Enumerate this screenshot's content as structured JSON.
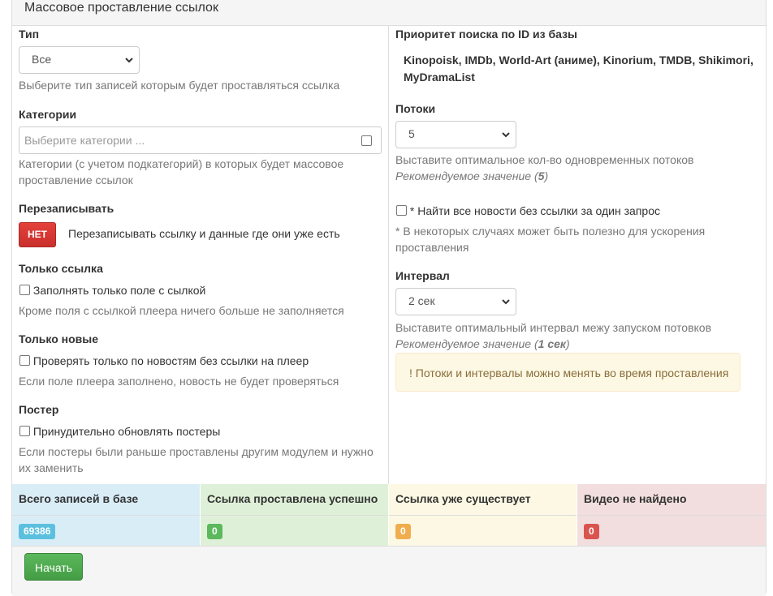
{
  "panel": {
    "title": "Массовое проставление ссылок"
  },
  "left": {
    "type": {
      "label": "Тип",
      "value": "Все",
      "help": "Выберите тип записей которым будет проставляться ссылка"
    },
    "categories": {
      "label": "Категории",
      "placeholder": "Выберите категории ...",
      "help_line1": "Категории (с учетом подкатегорий) в которых будет массовое",
      "help_line2": "проставление ссылок"
    },
    "overwrite": {
      "label": "Перезаписывать",
      "toggle": "НЕТ",
      "text": "Перезаписывать ссылку и данные где они уже есть"
    },
    "only_link": {
      "label": "Только ссылка",
      "checkbox": "Заполнять только поле с сылкой",
      "help": "Кроме поля с ссылкой плеера ничего больше не заполняется"
    },
    "only_new": {
      "label": "Только новые",
      "checkbox": "Проверять только по новостям без ссылки на плеер",
      "help": "Если поле плеера заполнено, новость не будет проверяться"
    },
    "poster": {
      "label": "Постер",
      "checkbox": "Принудительно обновлять постеры",
      "help_line1": "Если постеры были раньше проставлены другим модулем и нужно",
      "help_line2": "их заменить"
    }
  },
  "right": {
    "priority": {
      "label": "Приоритет поиска по ID из базы",
      "line1": "Kinopoisk, IMDb, World-Art (аниме), Kinorium, TMDB, Shikimori,",
      "line2": "MyDramaList"
    },
    "threads": {
      "label": "Потоки",
      "value": "5",
      "help": "Выставите оптимальное кол-во одновременных потоков",
      "recommended_prefix": "Рекомендуемое значение (",
      "recommended_value": "5",
      "recommended_suffix": ")"
    },
    "find_all": {
      "checkbox": "* Найти все новости без ссылки за один запрос",
      "help_line1": "* В некоторых случаях может быть полезно для ускорения",
      "help_line2": "проставления"
    },
    "interval": {
      "label": "Интервал",
      "value": "2 сек",
      "help": "Выставите оптимальный интервал межу запуском потовков",
      "recommended_prefix": "Рекомендуемое значение (",
      "recommended_value": "1 сек",
      "recommended_suffix": ")"
    },
    "alert": "! Потоки и интервалы можно менять во время проставления"
  },
  "stats": [
    {
      "header": "Всего записей в базе",
      "value": "69386",
      "bg": "#d9edf7",
      "badge": "#5bc0de"
    },
    {
      "header": "Ссылка проставлена успешно",
      "value": "0",
      "bg": "#dff0d8",
      "badge": "#5cb85c"
    },
    {
      "header": "Ссылка уже существует",
      "value": "0",
      "bg": "#fcf8e3",
      "badge": "#f0ad4e"
    },
    {
      "header": "Видео не найдено",
      "value": "0",
      "bg": "#f2dede",
      "badge": "#d9534f"
    }
  ],
  "footer": {
    "start_button": "Начать"
  },
  "icons": {
    "select_arrow": "chevron-down-icon"
  }
}
